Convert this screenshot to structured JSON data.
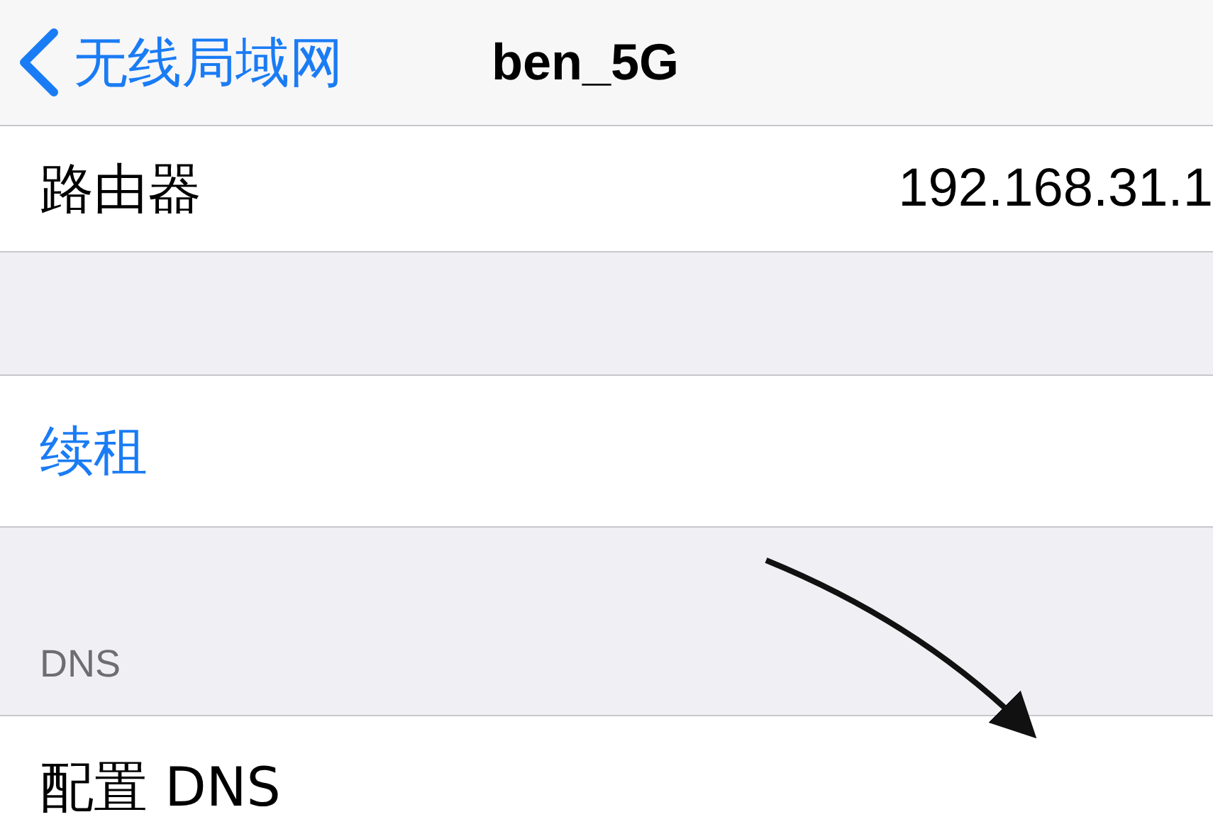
{
  "nav_bar": {
    "back_label": "无线局域网",
    "title": "ben_5G"
  },
  "sections": [
    {
      "rows": [
        {
          "kind": "value",
          "label": "路由器",
          "value": "192.168.31.1"
        }
      ]
    },
    {
      "rows": [
        {
          "kind": "action",
          "label": "续租"
        }
      ]
    },
    {
      "header": "DNS",
      "rows": [
        {
          "kind": "value",
          "label": "配置 DNS"
        }
      ]
    }
  ]
}
